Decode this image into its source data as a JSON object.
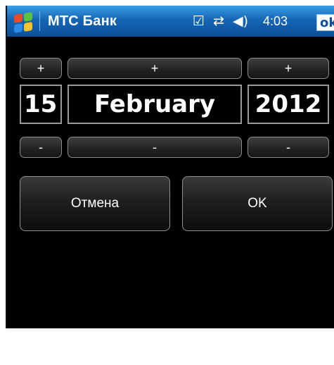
{
  "titlebar": {
    "app_title": "МТС Банк",
    "clock": "4:03",
    "ok_label": "ok",
    "icons": [
      "start-flag-icon",
      "checkbox-icon",
      "connectivity-icon",
      "volume-icon"
    ]
  },
  "date_picker": {
    "day": {
      "value": "15",
      "increment_label": "+",
      "decrement_label": "-"
    },
    "month": {
      "value": "February",
      "increment_label": "+",
      "decrement_label": "-"
    },
    "year": {
      "value": "2012",
      "increment_label": "+",
      "decrement_label": "-"
    }
  },
  "actions": {
    "cancel_label": "Отмена",
    "ok_label": "OK"
  }
}
